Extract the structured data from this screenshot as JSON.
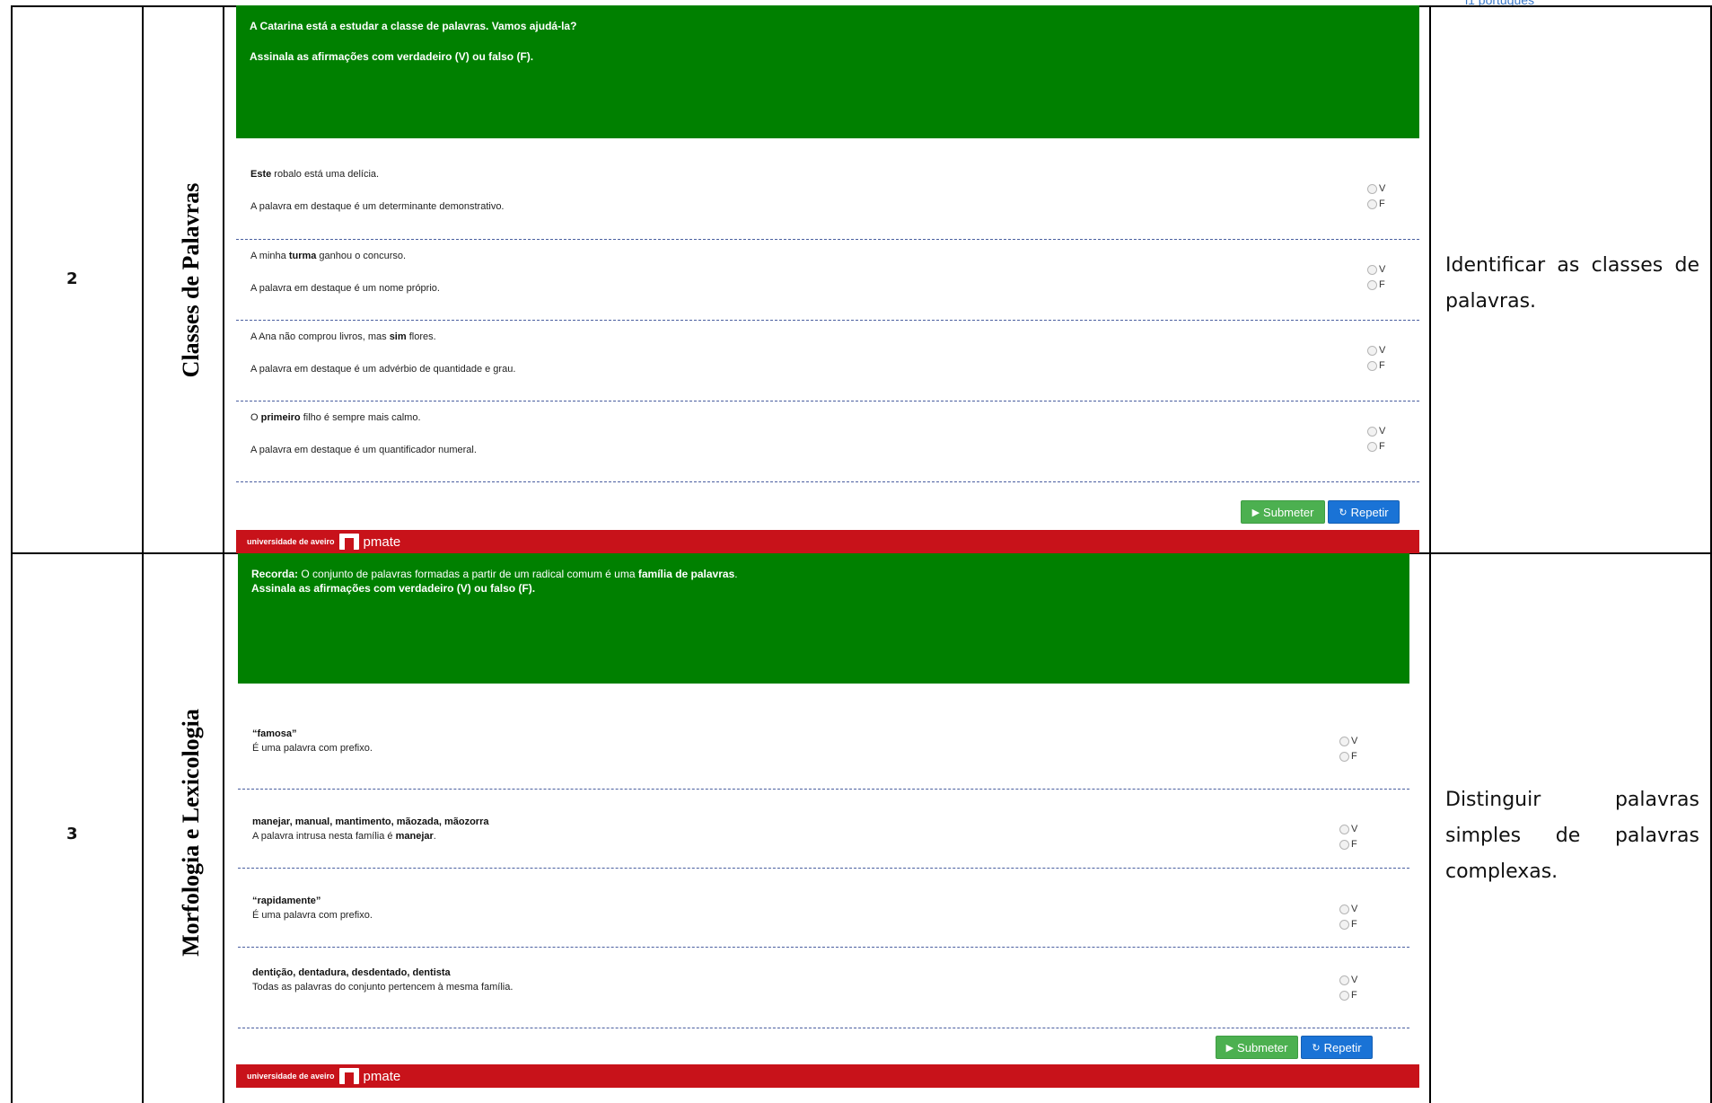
{
  "top_link": "l1 português",
  "rows": [
    {
      "number": "2",
      "domain": "Classes de Palavras",
      "objective": "Identificar as classes de palavras.",
      "quiz": {
        "header_line1": "A Catarina está a estudar a classe de palavras. Vamos ajudá-la?",
        "header_line2": "Assinala as afirmações com verdadeiro (V) ou falso (F).",
        "items": [
          {
            "pre": "",
            "bold": "Este",
            "post": " robalo está uma delícia.",
            "statement": "A palavra em destaque é um determinante demonstrativo."
          },
          {
            "pre": "A minha ",
            "bold": "turma",
            "post": " ganhou o concurso.",
            "statement": "A palavra em destaque é um nome próprio."
          },
          {
            "pre": "A Ana não comprou livros, mas ",
            "bold": "sim",
            "post": " flores.",
            "statement": "A palavra em destaque é um advérbio de quantidade e grau."
          },
          {
            "pre": "O ",
            "bold": "primeiro",
            "post": " filho é sempre mais calmo.",
            "statement": "A palavra em destaque é um quantificador numeral."
          }
        ],
        "option_v": "V",
        "option_f": "F",
        "submit_label": "Submeter",
        "repeat_label": "Repetir",
        "footer_uni": "universidade de aveiro",
        "footer_brand": "pmate"
      }
    },
    {
      "number": "3",
      "domain": "Morfologia e Lexicologia",
      "objective": "Distinguir palavras simples de palavras complexas.",
      "quiz": {
        "header_recorda": "Recorda:",
        "header_line1_mid": " O conjunto de palavras formadas a partir de um radical comum é uma ",
        "header_line1_bold": "família de palavras",
        "header_line1_end": ".",
        "header_line2": "Assinala as afirmações com verdadeiro (V) ou falso (F).",
        "items": [
          {
            "title": "“famosa”",
            "stmt_pre": "É uma palavra com prefixo.",
            "stmt_bold": "",
            "stmt_post": ""
          },
          {
            "title": "manejar, manual, mantimento, mãozada, mãozorra",
            "stmt_pre": "A palavra intrusa nesta família é ",
            "stmt_bold": "manejar",
            "stmt_post": "."
          },
          {
            "title": "“rapidamente”",
            "stmt_pre": "É uma palavra com prefixo.",
            "stmt_bold": "",
            "stmt_post": ""
          },
          {
            "title": "dentição, dentadura, desdentado, dentista",
            "stmt_pre": "Todas as palavras do conjunto pertencem à mesma família.",
            "stmt_bold": "",
            "stmt_post": ""
          }
        ],
        "option_v": "V",
        "option_f": "F",
        "submit_label": "Submeter",
        "repeat_label": "Repetir",
        "footer_uni": "universidade de aveiro",
        "footer_brand": "pmate"
      }
    }
  ],
  "colors": {
    "header_green": "#008000",
    "footer_red": "#c8121a",
    "submit_green": "#4cb050",
    "repeat_blue": "#1a73d6",
    "link_blue": "#3a78c8"
  }
}
